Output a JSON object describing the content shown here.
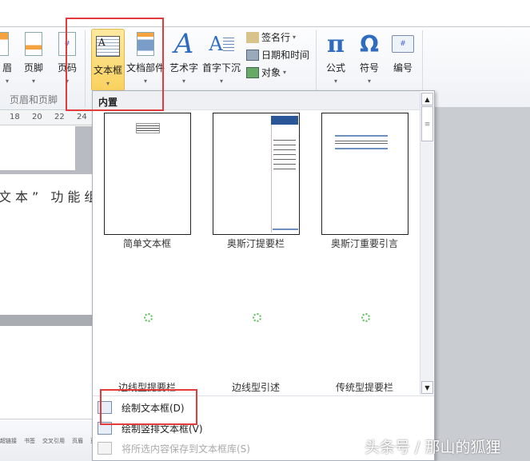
{
  "ribbon": {
    "buttons": [
      {
        "label": "眉",
        "icon": "header-icon"
      },
      {
        "label": "页脚",
        "icon": "footer-icon"
      },
      {
        "label": "页码",
        "icon": "page-number-icon"
      },
      {
        "label": "文本框",
        "icon": "text-box-icon"
      },
      {
        "label": "文档部件",
        "icon": "quick-parts-icon"
      },
      {
        "label": "艺术字",
        "icon": "wordart-icon"
      },
      {
        "label": "首字下沉",
        "icon": "drop-cap-icon"
      },
      {
        "label": "公式",
        "icon": "equation-icon"
      },
      {
        "label": "符号",
        "icon": "symbol-icon"
      },
      {
        "label": "编号",
        "icon": "number-icon"
      }
    ],
    "small": [
      {
        "label": "签名行",
        "icon": "signature-line-icon"
      },
      {
        "label": "日期和时间",
        "icon": "date-time-icon"
      },
      {
        "label": "对象",
        "icon": "object-icon"
      }
    ],
    "group_label": "页眉和页脚",
    "ruler_ticks": [
      "18",
      "20",
      "22",
      "24"
    ]
  },
  "document": {
    "text": "文本” 功能组"
  },
  "dropdown": {
    "header": "内置",
    "gallery": [
      "简单文本框",
      "奥斯汀提要栏",
      "奥斯汀重要引言",
      "边线型提要栏",
      "边线型引述",
      "传统型提要栏"
    ],
    "sample_title": "[键入文档的引述]",
    "menu": [
      {
        "label": "绘制文本框(D)",
        "enabled": true
      },
      {
        "label": "绘制竖排文本框(V)",
        "enabled": true
      },
      {
        "label": "将所选内容保存到文本框库(S)",
        "enabled": false
      }
    ]
  },
  "bottom_ribbon": [
    "超链接",
    "书签",
    "交叉引用",
    "页眉",
    "页脚"
  ],
  "watermark": "头条号 / 那山的狐狸",
  "colors": {
    "highlight": "#e33b3b",
    "accent": "#2a5597"
  }
}
